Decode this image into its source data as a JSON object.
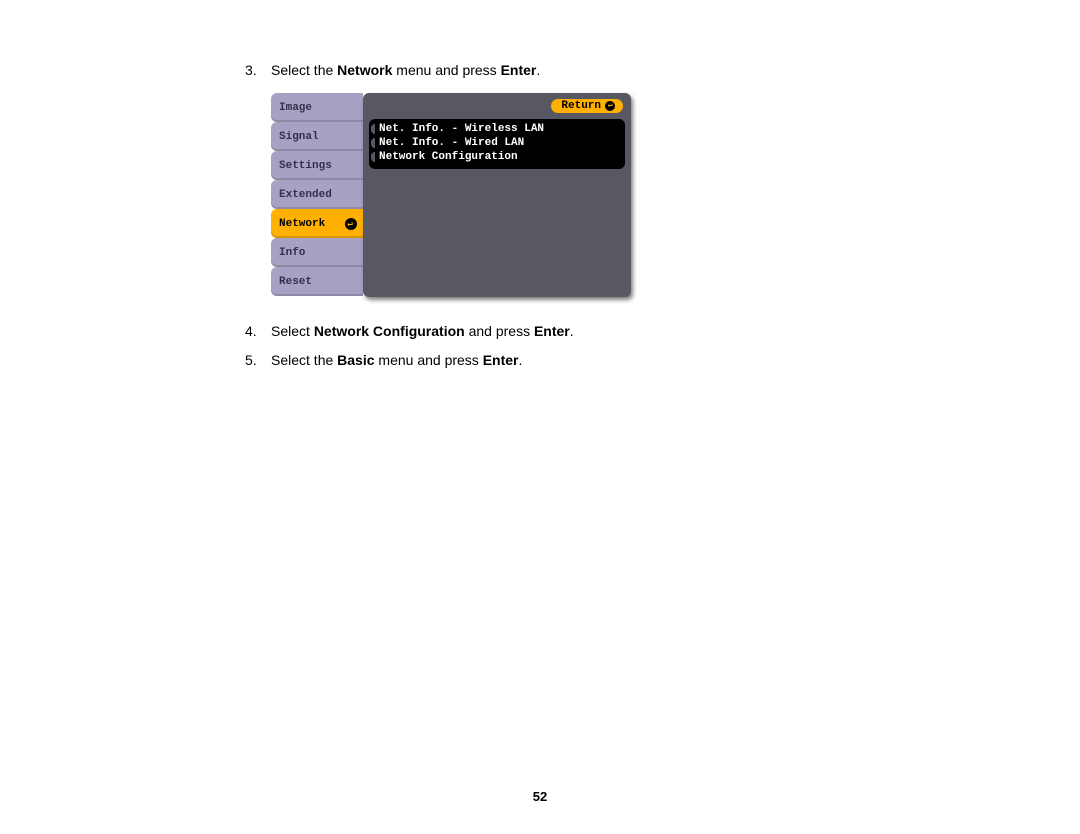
{
  "steps": [
    {
      "num": "3.",
      "parts": [
        "Select the ",
        "Network",
        " menu and press ",
        "Enter",
        "."
      ]
    },
    {
      "num": "4.",
      "parts": [
        "Select ",
        "Network Configuration",
        " and press ",
        "Enter",
        "."
      ]
    },
    {
      "num": "5.",
      "parts": [
        "Select the ",
        "Basic",
        " menu and press ",
        "Enter",
        "."
      ]
    }
  ],
  "osd": {
    "tabs": [
      "Image",
      "Signal",
      "Settings",
      "Extended",
      "Network",
      "Info",
      "Reset"
    ],
    "active_tab_index": 4,
    "return_label": "Return",
    "items": [
      "Net. Info. - Wireless LAN",
      "Net. Info. - Wired LAN",
      "Network Configuration"
    ]
  },
  "page_number": "52"
}
